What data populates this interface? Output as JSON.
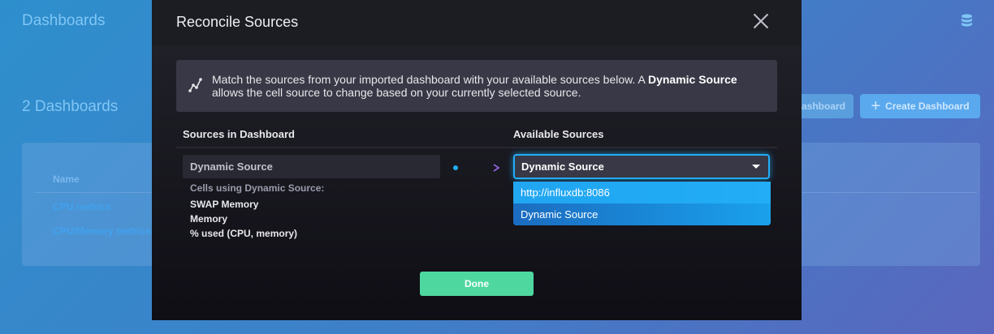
{
  "background": {
    "title": "Dashboards",
    "count_title": "2 Dashboards",
    "import_button": "ashboard",
    "create_button": "Create Dashboard",
    "table": {
      "column_name": "Name",
      "rows": [
        "CPU metrics",
        "CPU/Memory metrics"
      ]
    }
  },
  "modal": {
    "title": "Reconcile Sources",
    "info": {
      "text_before": "Match the sources from your imported dashboard with your available sources below. A ",
      "highlight": "Dynamic Source",
      "text_after": " allows the cell source to change based on your currently selected source."
    },
    "columns": {
      "left": "Sources in Dashboard",
      "right": "Available Sources"
    },
    "source": {
      "name": "Dynamic Source",
      "cells_label": "Cells using Dynamic Source:",
      "cells": [
        "SWAP Memory",
        "Memory",
        "% used (CPU, memory)"
      ]
    },
    "dropdown": {
      "selected": "Dynamic Source",
      "options": [
        "http://influxdb:8086",
        "Dynamic Source"
      ]
    },
    "done_button": "Done"
  },
  "colors": {
    "accent": "#22adf6",
    "success": "#4ed8a0",
    "modal_bg": "#0f0e15"
  },
  "icons": [
    "database-icon",
    "plus-icon",
    "close-icon",
    "graph-icon",
    "arrow-right-icon",
    "caret-down-icon"
  ]
}
